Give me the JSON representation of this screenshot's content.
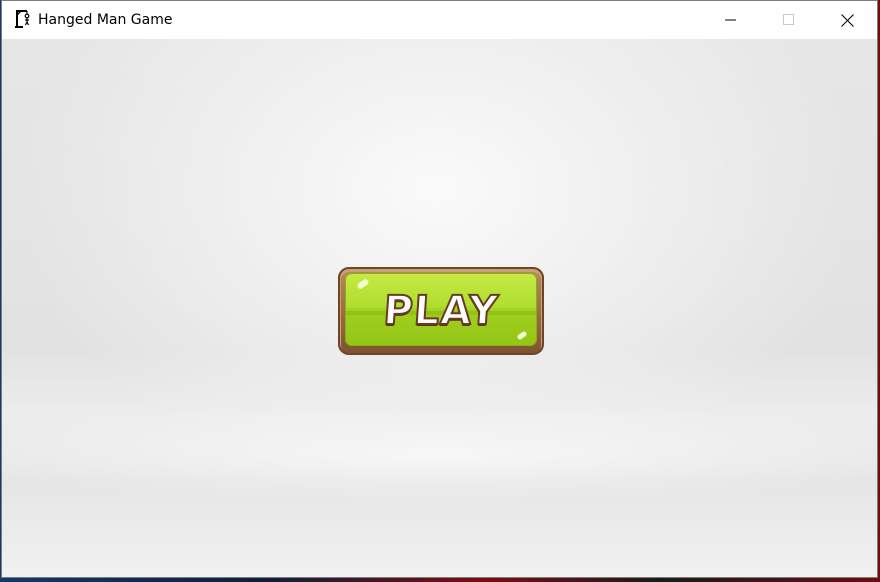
{
  "window": {
    "title": "Hanged Man Game",
    "app_icon": "gallows-icon"
  },
  "caption_buttons": {
    "minimize": "minimize-icon",
    "maximize": "maximize-icon",
    "close": "close-icon"
  },
  "main": {
    "play_label": "PLAY"
  },
  "colors": {
    "button_face": "#b0de2f",
    "button_frame": "#9a6a40",
    "label_outline": "#6a3a22",
    "background": "#e6e6e6"
  }
}
